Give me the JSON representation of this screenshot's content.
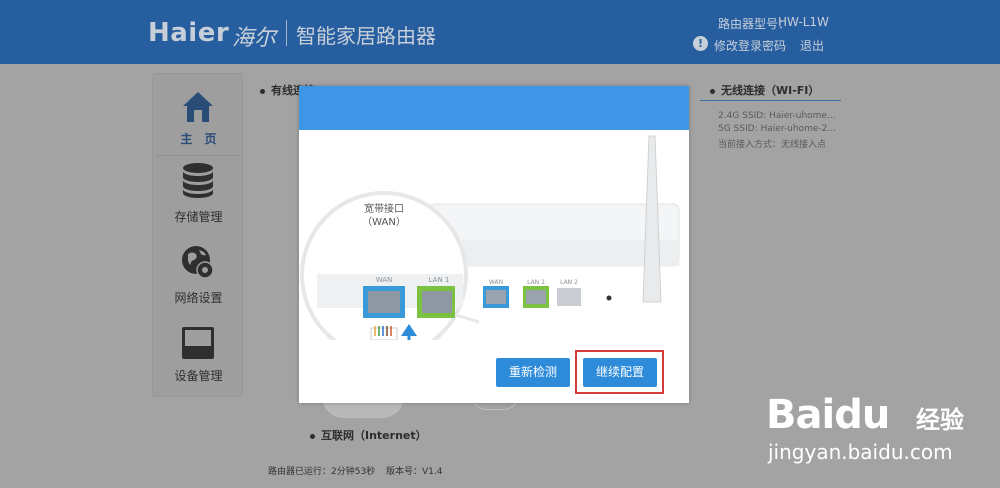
{
  "header": {
    "logo_text": "Haier",
    "logo_cn": "海尔",
    "product_name": "智能家居路由器",
    "model_label": "路由器型号：",
    "model_value": "HW-L1W",
    "alert_glyph": "!",
    "change_password": "修改登录密码",
    "logout": "退出"
  },
  "sidebar": {
    "items": [
      {
        "label": "主　页",
        "icon": "home-icon",
        "active": true
      },
      {
        "label": "存储管理",
        "icon": "database-icon"
      },
      {
        "label": "网络设置",
        "icon": "globe-gear-icon"
      },
      {
        "label": "设备管理",
        "icon": "device-icon"
      }
    ]
  },
  "background": {
    "wired_title": "有线连接",
    "wifi_title": "无线连接（WI-FI）",
    "wifi_lines": [
      "2.4G SSID: Haier-uhome...",
      "5G SSID: Haier-uhome-2...",
      "当前接入方式：无线接入点"
    ],
    "internet_label": "互联网（Internet）",
    "uptime": "路由器已运行：2分钟53秒",
    "version": "版本号：V1.4"
  },
  "modal": {
    "port_title_line1": "宽带接口",
    "port_title_line2": "（WAN）",
    "port_wan": "WAN",
    "port_lan1": "LAN 1",
    "router_ports": [
      "WAN",
      "LAN 1",
      "LAN 2"
    ],
    "redetect_label": "重新检测",
    "continue_label": "继续配置"
  },
  "watermark": {
    "brand": "Baidu",
    "brand_cn": "经验",
    "url": "jingyan.baidu.com"
  },
  "colors": {
    "header_bg": "#275ea0",
    "accent_blue": "#3f96e6",
    "wan_blue": "#3a9ad9",
    "lan_green": "#7cc242",
    "highlight_red": "#d33b3b"
  }
}
